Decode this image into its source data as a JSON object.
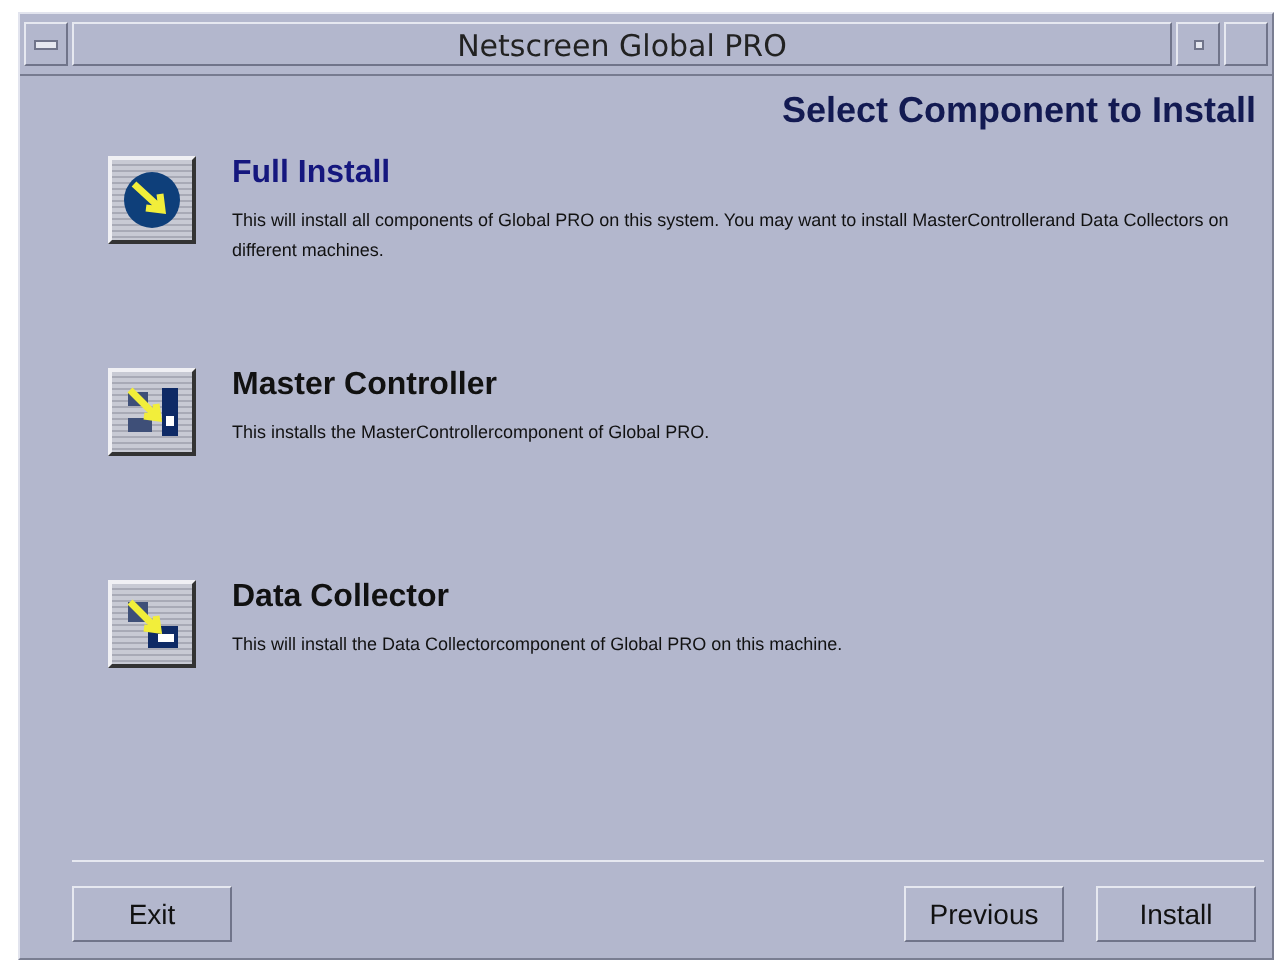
{
  "window": {
    "title": "Netscreen Global PRO"
  },
  "heading": "Select Component to Install",
  "options": [
    {
      "kind": "full",
      "title": "Full Install",
      "selected": true,
      "description": "This will install all components of Global PRO on this system.  You may want to install MasterControllerand Data Collectors on different machines."
    },
    {
      "kind": "controller",
      "title": "Master Controller",
      "selected": false,
      "description": "This installs the MasterControllercomponent of Global PRO."
    },
    {
      "kind": "collector",
      "title": "Data Collector",
      "selected": false,
      "description": "This will install the Data Collectorcomponent of Global PRO on this machine."
    }
  ],
  "buttons_left": [
    "Exit"
  ],
  "buttons_right": [
    "Previous",
    "Install"
  ]
}
